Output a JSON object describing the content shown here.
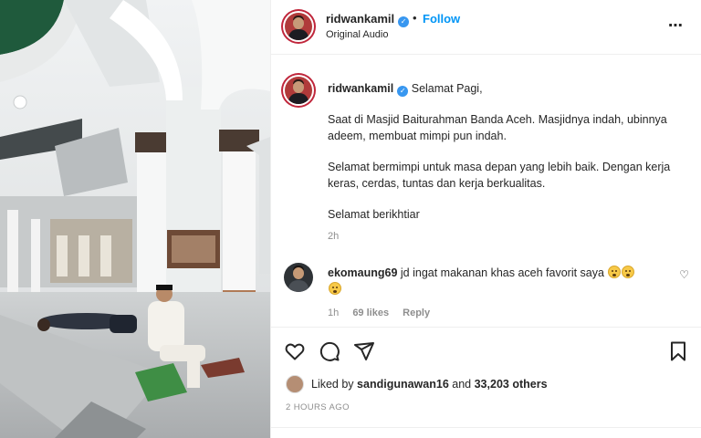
{
  "post": {
    "username": "ridwankamil",
    "verified_glyph": "✓",
    "separator": "•",
    "follow_label": "Follow",
    "audio_label": "Original Audio",
    "more_icon": "⋯"
  },
  "caption": {
    "greeting": "Selamat Pagi,",
    "paragraph1": "Saat di Masjid Baiturahman Banda Aceh. Masjidnya indah, ubinnya adeem, membuat mimpi pun indah.",
    "paragraph2": "Selamat bermimpi untuk masa depan yang lebih baik. Dengan kerja keras, cerdas, tuntas dan kerja berkualitas.",
    "paragraph3": "Selamat berikhtiar",
    "time": "2h"
  },
  "comment": {
    "username": "ekomaung69",
    "text": "jd ingat makanan khas aceh favorit saya",
    "time": "1h",
    "likes": "69 likes",
    "reply_label": "Reply",
    "heart_icon": "♡"
  },
  "likes": {
    "prefix": "Liked by",
    "user": "sandigunawan16",
    "suffix": "and",
    "others": "33,203 others"
  },
  "timestamp": "2 HOURS AGO",
  "icons": [
    "heart-icon",
    "comment-icon",
    "share-icon",
    "bookmark-icon",
    "more-options-icon"
  ]
}
